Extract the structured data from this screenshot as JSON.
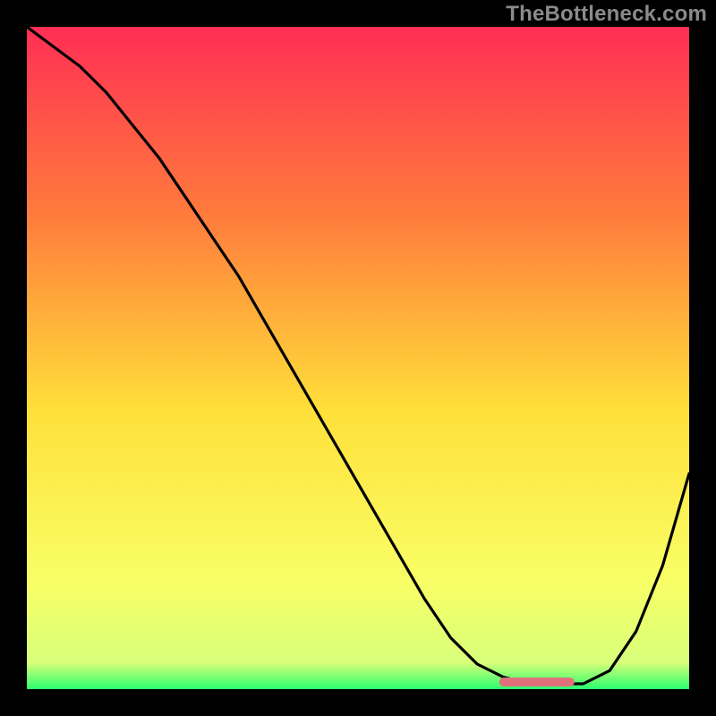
{
  "watermark": "TheBottleneck.com",
  "colors": {
    "frame_bg": "#000000",
    "grad_top": "#ff2e55",
    "grad_mid1": "#ff7a3c",
    "grad_mid2": "#ffe03a",
    "grad_low": "#f8ff66",
    "grad_green": "#2bff6e",
    "curve_stroke": "#000000",
    "bottom_accent": "#e0707a"
  },
  "chart_data": {
    "type": "line",
    "title": "",
    "xlabel": "",
    "ylabel": "",
    "xlim": [
      0,
      100
    ],
    "ylim": [
      0,
      100
    ],
    "series": [
      {
        "name": "bottleneck-curve",
        "x": [
          0,
          4,
          8,
          12,
          16,
          20,
          24,
          28,
          32,
          36,
          40,
          44,
          48,
          52,
          56,
          60,
          64,
          68,
          72,
          76,
          80,
          84,
          88,
          92,
          96,
          100
        ],
        "y": [
          100,
          97,
          94,
          90,
          85,
          80,
          74,
          68,
          62,
          55,
          48,
          41,
          34,
          27,
          20,
          13,
          7,
          3,
          1,
          0,
          0,
          0,
          2,
          8,
          18,
          32
        ]
      }
    ],
    "annotations": [
      {
        "name": "optimal-band",
        "x_start": 72,
        "x_end": 82,
        "y": 0
      }
    ]
  }
}
